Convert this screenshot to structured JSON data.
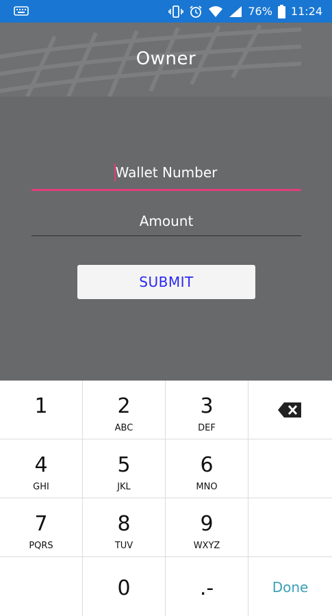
{
  "status_bar": {
    "battery": "76%",
    "time": "11:24",
    "icons": [
      "keyboard-icon",
      "vibrate-icon",
      "alarm-icon",
      "wifi-icon",
      "signal-icon",
      "battery-icon"
    ]
  },
  "header": {
    "title": "Owner"
  },
  "form": {
    "wallet_placeholder": "Wallet Number",
    "amount_placeholder": "Amount",
    "submit_label": "SUBMIT",
    "accent_color": "#e33d7a",
    "submit_text_color": "#2a27f0"
  },
  "keypad": {
    "keys": [
      {
        "num": "1",
        "letters": ""
      },
      {
        "num": "2",
        "letters": "ABC"
      },
      {
        "num": "3",
        "letters": "DEF"
      },
      {
        "num": "4",
        "letters": "GHI"
      },
      {
        "num": "5",
        "letters": "JKL"
      },
      {
        "num": "6",
        "letters": "MNO"
      },
      {
        "num": "7",
        "letters": "PQRS"
      },
      {
        "num": "8",
        "letters": "TUV"
      },
      {
        "num": "9",
        "letters": "WXYZ"
      }
    ],
    "zero": "0",
    "dot_dash": ".-",
    "done": "Done",
    "done_color": "#3aa0b6"
  }
}
